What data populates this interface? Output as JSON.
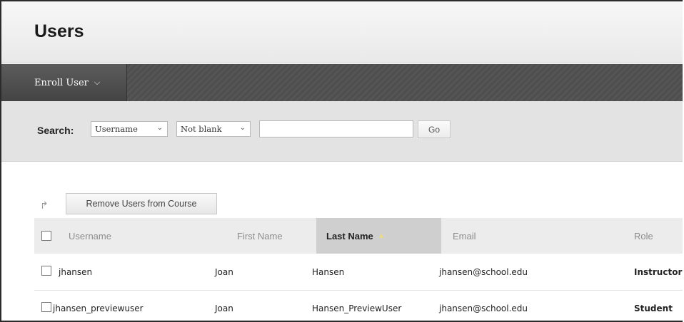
{
  "page": {
    "title": "Users"
  },
  "action_bar": {
    "enroll_label": "Enroll User",
    "enroll_icon": "chevron-down-icon"
  },
  "search": {
    "label": "Search:",
    "field_select": "Username",
    "operator_select": "Not blank",
    "input_value": "",
    "go_label": "Go"
  },
  "bulk": {
    "remove_label": "Remove Users from Course"
  },
  "table": {
    "columns": [
      "Username",
      "First Name",
      "Last Name",
      "Email",
      "Role"
    ],
    "sorted_column": "Last Name",
    "rows": [
      {
        "username": "jhansen",
        "first": "Joan",
        "last": "Hansen",
        "email": "jhansen@school.edu",
        "role": "Instructor"
      },
      {
        "username": "jhansen_previewuser",
        "first": "Joan",
        "last": "Hansen_PreviewUser",
        "email": "jhansen@school.edu",
        "role": "Student"
      }
    ]
  }
}
